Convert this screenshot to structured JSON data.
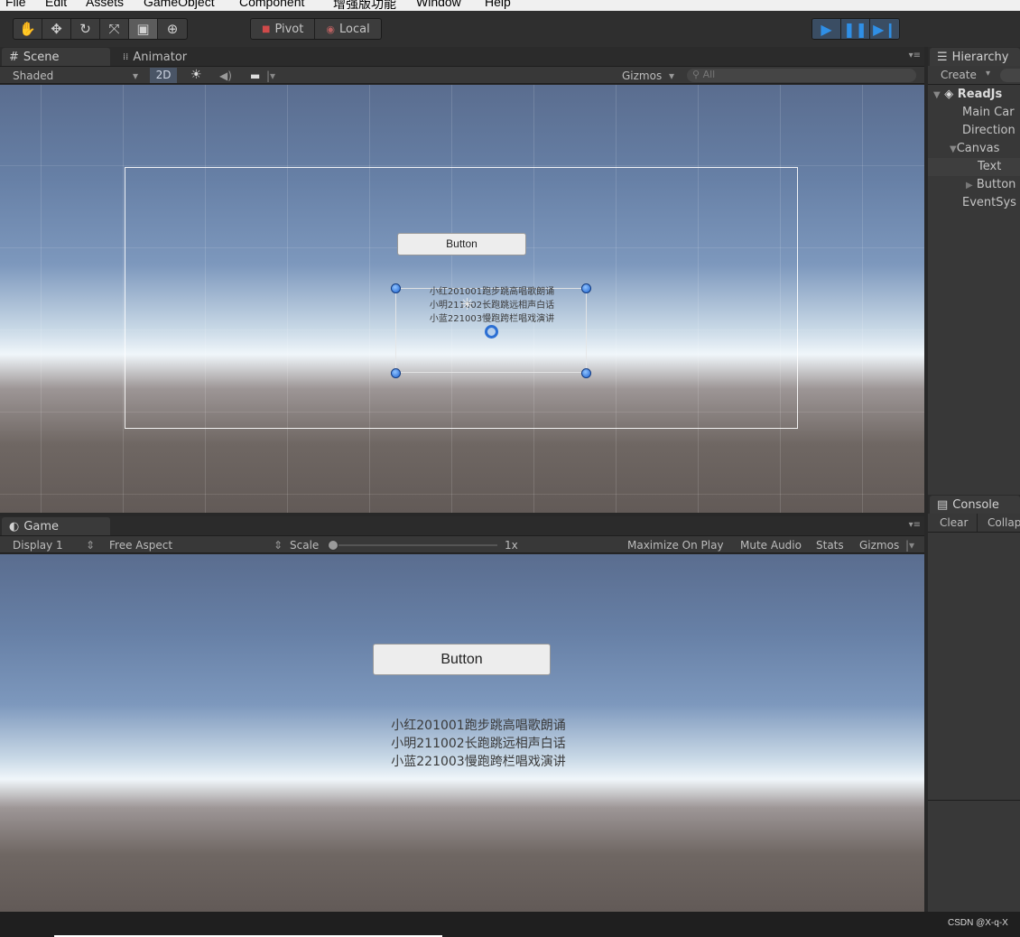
{
  "menubar": {
    "items": [
      "File",
      "Edit",
      "Assets",
      "GameObject",
      "Component",
      "增强版功能",
      "Window",
      "Help"
    ]
  },
  "toolbar": {
    "transform_tools": [
      "hand-tool-icon",
      "move-tool-icon",
      "rotate-tool-icon",
      "scale-tool-icon",
      "rect-tool-icon",
      "transform-tool-icon"
    ],
    "active_tool_index": 4,
    "pivot_label": "Pivot",
    "local_label": "Local",
    "play_controls": [
      "play-icon",
      "pause-icon",
      "step-icon"
    ]
  },
  "scene": {
    "tab_label": "Scene",
    "tab2_label": "Animator",
    "shading_mode": "Shaded",
    "mode_2d": "2D",
    "gizmos_label": "Gizmos",
    "search_placeholder": "All",
    "button_label": "Button",
    "text_lines": "小红201001跑步跳高唱歌朗诵\n小明211002长跑跳远相声白话\n小蓝221003慢跑跨栏唱戏演讲"
  },
  "game": {
    "tab_label": "Game",
    "display": "Display 1",
    "aspect": "Free Aspect",
    "scale_label": "Scale",
    "scale_value": "1x",
    "maximize_label": "Maximize On Play",
    "mute_label": "Mute Audio",
    "stats_label": "Stats",
    "gizmos_label": "Gizmos",
    "button_label": "Button",
    "text_lines": "小红201001跑步跳高唱歌朗诵\n小明211002长跑跳远相声白话\n小蓝221003慢跑跨栏唱戏演讲"
  },
  "hierarchy": {
    "tab_label": "Hierarchy",
    "create_label": "Create",
    "scene_name": "ReadJs",
    "items": [
      "Main Car",
      "Direction",
      "Canvas",
      "Text",
      "Button",
      "EventSys"
    ],
    "selected_index": 3
  },
  "console": {
    "tab_label": "Console",
    "clear_label": "Clear",
    "collapse_label": "Collap"
  },
  "watermark": "CSDN @X-q-X",
  "colors": {
    "accent_blue": "#2f8fe6",
    "panel_bg": "#383838",
    "dark_bg": "#282828"
  }
}
